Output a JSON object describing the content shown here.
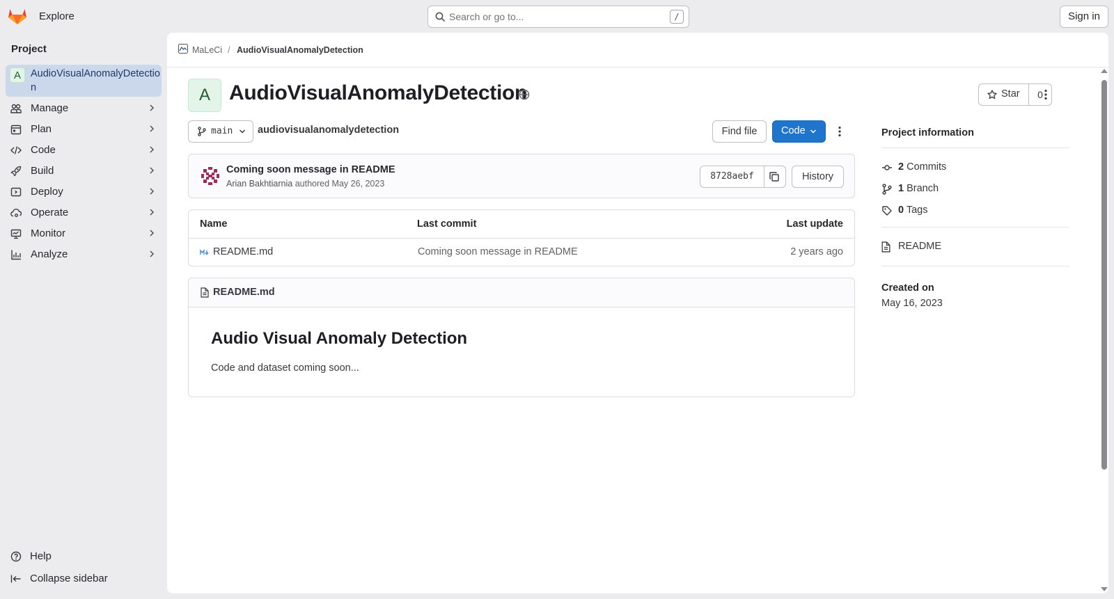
{
  "topbar": {
    "explore_label": "Explore",
    "search_placeholder": "Search or go to...",
    "search_shortcut": "/",
    "signin_label": "Sign in",
    "logo_icon": "gitlab-tanuki-icon"
  },
  "sidebar": {
    "heading": "Project",
    "project": {
      "avatar_letter": "A",
      "name": "AudioVisualAnomalyDetection"
    },
    "items": [
      {
        "label": "Manage",
        "icon": "users-icon"
      },
      {
        "label": "Plan",
        "icon": "planning-icon"
      },
      {
        "label": "Code",
        "icon": "code-icon"
      },
      {
        "label": "Build",
        "icon": "rocket-icon"
      },
      {
        "label": "Deploy",
        "icon": "deployments-icon"
      },
      {
        "label": "Operate",
        "icon": "cloud-gear-icon"
      },
      {
        "label": "Monitor",
        "icon": "monitor-icon"
      },
      {
        "label": "Analyze",
        "icon": "chart-icon"
      }
    ],
    "footer": {
      "help_label": "Help",
      "collapse_label": "Collapse sidebar"
    }
  },
  "breadcrumb": {
    "group": "MaLeCi",
    "separator": "/",
    "project": "AudioVisualAnomalyDetection"
  },
  "project": {
    "avatar_letter": "A",
    "title": "AudioVisualAnomalyDetection",
    "visibility_icon": "globe-icon",
    "star_label": "Star",
    "star_count": "0"
  },
  "repo_toolbar": {
    "branch": "main",
    "path": "audiovisualanomalydetection",
    "find_file_label": "Find file",
    "code_label": "Code"
  },
  "last_commit": {
    "message": "Coming soon message in README",
    "author": "Arian Bakhtiarnia",
    "authored_text": "authored",
    "date": "May 26, 2023",
    "sha": "8728aebf",
    "history_label": "History"
  },
  "file_table": {
    "headers": {
      "name": "Name",
      "last_commit": "Last commit",
      "last_update": "Last update"
    },
    "rows": [
      {
        "name": "README.md",
        "last_commit": "Coming soon message in README",
        "last_update": "2 years ago",
        "icon": "markdown-icon"
      }
    ]
  },
  "readme": {
    "filename": "README.md",
    "heading": "Audio Visual Anomaly Detection",
    "body": "Code and dataset coming soon..."
  },
  "project_info": {
    "title": "Project information",
    "commits_count": "2",
    "commits_label": "Commits",
    "branch_count": "1",
    "branch_label": "Branch",
    "tags_count": "0",
    "tags_label": "Tags",
    "readme_label": "README",
    "created_label": "Created on",
    "created_date": "May 16, 2023"
  },
  "colors": {
    "page_bg": "#ececef",
    "panel_bg": "#ffffff",
    "primary": "#1f75cb",
    "sidebar_active": "#cbd8ec",
    "gitlab_orange": "#e24329"
  }
}
